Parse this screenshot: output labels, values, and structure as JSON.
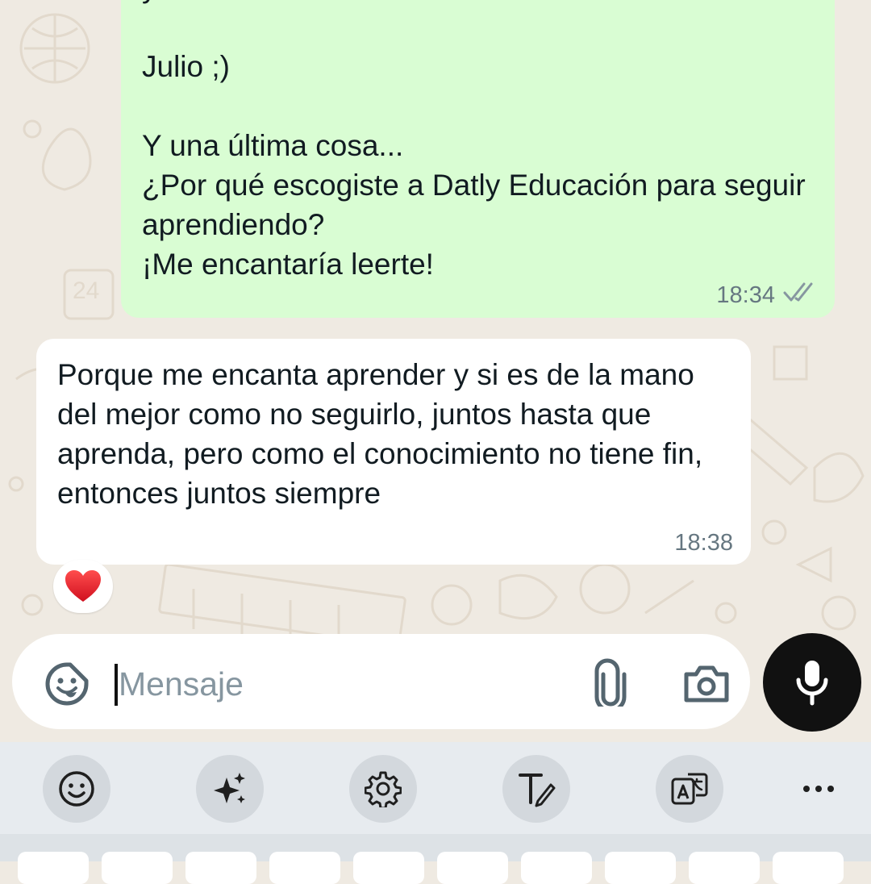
{
  "chat": {
    "outgoing": {
      "text": "y viste el video\n\nJulio ;)\n\nY una última cosa...\n¿Por qué escogiste a Datly Educación para seguir aprendiendo?\n¡Me encantaría leerte!",
      "time": "18:34",
      "status": "read"
    },
    "incoming": {
      "text": "Porque me encanta aprender y si es de la mano del mejor como no seguirlo, juntos hasta que aprenda, pero como el conocimiento no tiene fin, entonces juntos siempre",
      "time": "18:38",
      "reaction": "❤️"
    }
  },
  "composer": {
    "placeholder": "Mensaje",
    "icons": [
      "sticker-icon",
      "attach-icon",
      "camera-icon",
      "mic-icon"
    ]
  },
  "keyboard_toolbar": {
    "icons": [
      "emoji-icon",
      "sparkle-icon",
      "settings-icon",
      "handwriting-icon",
      "translate-icon",
      "more-icon"
    ]
  },
  "colors": {
    "outgoing_bubble": "#d9fdd3",
    "incoming_bubble": "#ffffff",
    "wallpaper": "#efeae2",
    "meta_text": "#667781",
    "tick": "#8696a0"
  }
}
